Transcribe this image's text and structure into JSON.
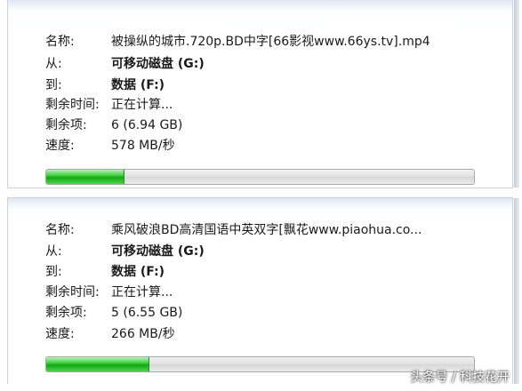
{
  "dialogs": [
    {
      "name_label": "名称:",
      "name_value": "被操纵的城市.720p.BD中字[66影视www.66ys.tv].mp4",
      "from_label": "从:",
      "from_value": "可移动磁盘 (G:)",
      "to_label": "到:",
      "to_value": "数据 (F:)",
      "time_label": "剩余时间:",
      "time_value": "正在计算...",
      "items_label": "剩余项:",
      "items_value": "6 (6.94 GB)",
      "speed_label": "速度:",
      "speed_value": "578 MB/秒",
      "progress": 0.18
    },
    {
      "name_label": "名称:",
      "name_value": "乘风破浪BD高清国语中英双字[飘花www.piaohua.co...",
      "from_label": "从:",
      "from_value": "可移动磁盘 (G:)",
      "to_label": "到:",
      "to_value": "数据 (F:)",
      "time_label": "剩余时间:",
      "time_value": "正在计算...",
      "items_label": "剩余项:",
      "items_value": "5 (6.55 GB)",
      "speed_label": "速度:",
      "speed_value": "266 MB/秒",
      "progress": 0.24
    }
  ],
  "watermark": "头条号 / 科技花开"
}
